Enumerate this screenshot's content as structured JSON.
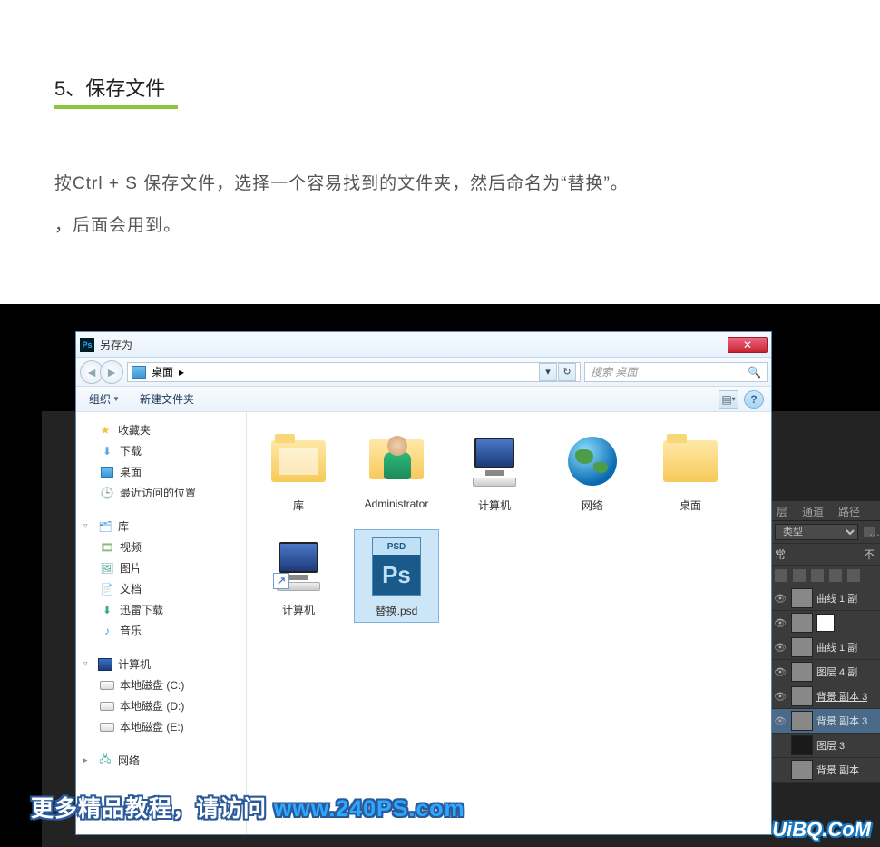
{
  "article": {
    "heading": "5、保存文件",
    "body_line1": "按Ctrl + S 保存文件，选择一个容易找到的文件夹，然后命名为“替换”。",
    "body_line2": "，后面会用到。"
  },
  "panel": {
    "tab_layer": "层",
    "tab_channel": "通道",
    "tab_path": "路径",
    "kind": "类型",
    "blend": "常",
    "opacity_suffix": "不",
    "layers": [
      {
        "label": "曲线 1 副"
      },
      {
        "label": "曲线 1 副"
      },
      {
        "label": "图层 4 副"
      },
      {
        "label": "背景 副本 3"
      },
      {
        "label": "背景 副本 3"
      },
      {
        "label": "图层 3"
      },
      {
        "label": "背景 副本"
      }
    ]
  },
  "dialog": {
    "title": "另存为",
    "crumb": "桌面",
    "crumb_arrow": "▸",
    "search_placeholder": "搜索 桌面",
    "toolbar": {
      "organize": "组织",
      "new_folder": "新建文件夹"
    },
    "sidebar": {
      "favorites": "收藏夹",
      "downloads": "下载",
      "desktop": "桌面",
      "recent": "最近访问的位置",
      "library": "库",
      "video": "视频",
      "pictures": "图片",
      "documents": "文档",
      "thunder": "迅雷下载",
      "music": "音乐",
      "computer": "计算机",
      "disk_c": "本地磁盘 (C:)",
      "disk_d": "本地磁盘 (D:)",
      "disk_e": "本地磁盘 (E:)",
      "network": "网络"
    },
    "files": {
      "library": "库",
      "admin": "Administrator",
      "computer": "计算机",
      "network": "网络",
      "desktop": "桌面",
      "computer2": "计算机",
      "psd_badge": "PSD",
      "psd_body": "Ps",
      "psd_label": "替换.psd"
    }
  },
  "watermark": {
    "text": "更多精品教程，请访问 ",
    "link": "www.240PS.com",
    "brand": "UiBQ.CoM"
  }
}
